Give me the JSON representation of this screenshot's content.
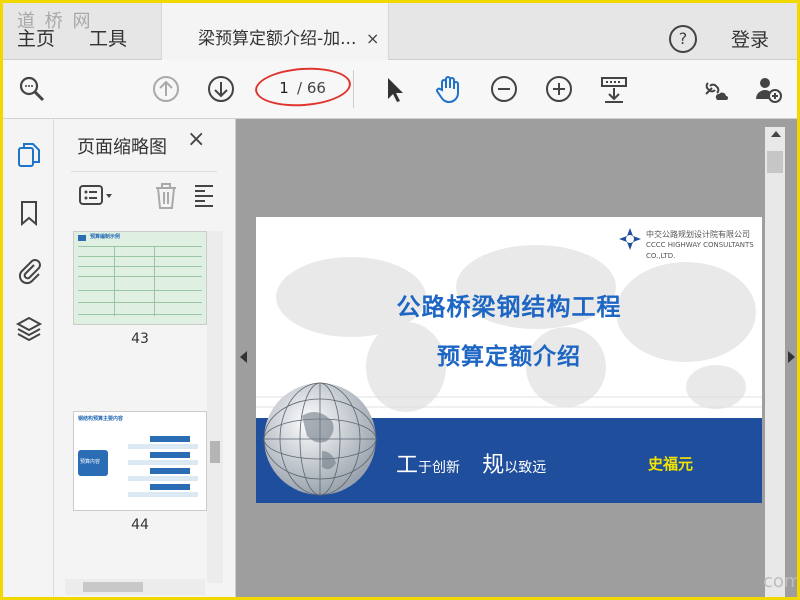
{
  "watermark": "道 桥 网",
  "tabs": {
    "home": "主页",
    "tools": "工具",
    "doc_title": "梁预算定额介绍-加...",
    "close": "×"
  },
  "header": {
    "help": "?",
    "login": "登录"
  },
  "toolbar": {
    "current_page": "1",
    "total_pages": "/ 66",
    "icons": [
      "search-zoom-icon",
      "page-up-icon",
      "page-down-icon",
      "select-pointer-icon",
      "hand-pan-icon",
      "zoom-out-icon",
      "zoom-in-icon",
      "fit-page-icon",
      "share-link-icon",
      "add-user-icon"
    ]
  },
  "sidebar": {
    "icons": [
      "pages-icon",
      "bookmark-icon",
      "attachment-icon",
      "layers-icon"
    ]
  },
  "thumbnails": {
    "title": "页面缩略图",
    "close": "×",
    "pages": [
      {
        "number": "43",
        "heading": "预算编制示例"
      },
      {
        "number": "44",
        "heading": "钢结构预算主要内容",
        "badge": "预算内容"
      }
    ]
  },
  "slide": {
    "company_cn": "中交公路规划设计院有限公司",
    "company_en": "CCCC HIGHWAY CONSULTANTS CO.,LTD.",
    "title_line1": "公路桥梁钢结构工程",
    "title_line2": "预算定额介绍",
    "slogan_char1": "工",
    "slogan_text1": "于创新",
    "slogan_char2": "规",
    "slogan_text2": "以致远",
    "author": "史福元"
  },
  "corner_mark": "com",
  "colors": {
    "accent_blue": "#1e66c4",
    "band_blue": "#1f4e9c",
    "author_yellow": "#f2e400",
    "annotation_red": "#e0342e",
    "frame_yellow": "#f0d800"
  }
}
